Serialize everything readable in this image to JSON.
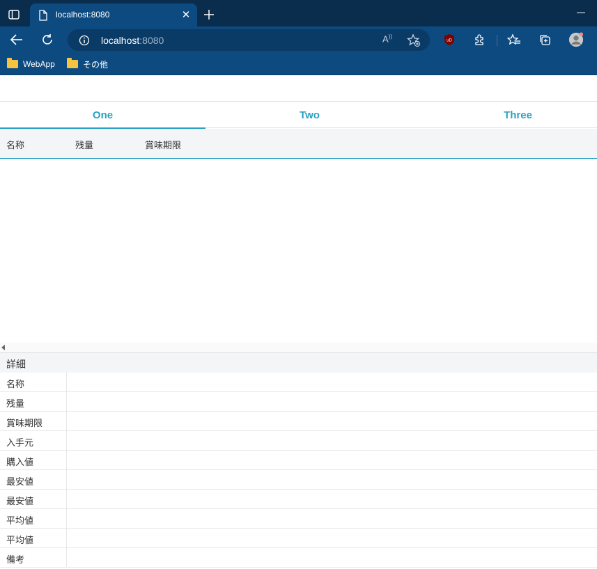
{
  "browser": {
    "tab_title": "localhost:8080",
    "address_host": "localhost",
    "address_port": ":8080",
    "read_aloud": "A",
    "bookmarks": [
      {
        "label": "WebApp"
      },
      {
        "label": "その他"
      }
    ],
    "extension_badge": "uD"
  },
  "app": {
    "tabs": [
      {
        "label": "One"
      },
      {
        "label": "Two"
      },
      {
        "label": "Three"
      }
    ],
    "active_tab": "One",
    "grid": {
      "columns": [
        "名称",
        "残量",
        "賞味期限"
      ]
    },
    "detail": {
      "title": "詳細",
      "fields": [
        {
          "label": "名称",
          "value": ""
        },
        {
          "label": "残量",
          "value": ""
        },
        {
          "label": "賞味期限",
          "value": ""
        },
        {
          "label": "入手元",
          "value": ""
        },
        {
          "label": "購入値",
          "value": ""
        },
        {
          "label": "最安値",
          "value": ""
        },
        {
          "label": "最安値",
          "value": ""
        },
        {
          "label": "平均値",
          "value": ""
        },
        {
          "label": "平均値",
          "value": ""
        },
        {
          "label": "備考",
          "value": ""
        }
      ]
    }
  },
  "colors": {
    "accent": "#2aa1c3",
    "chrome_dark": "#0a2d4d",
    "chrome": "#0d4a80"
  }
}
